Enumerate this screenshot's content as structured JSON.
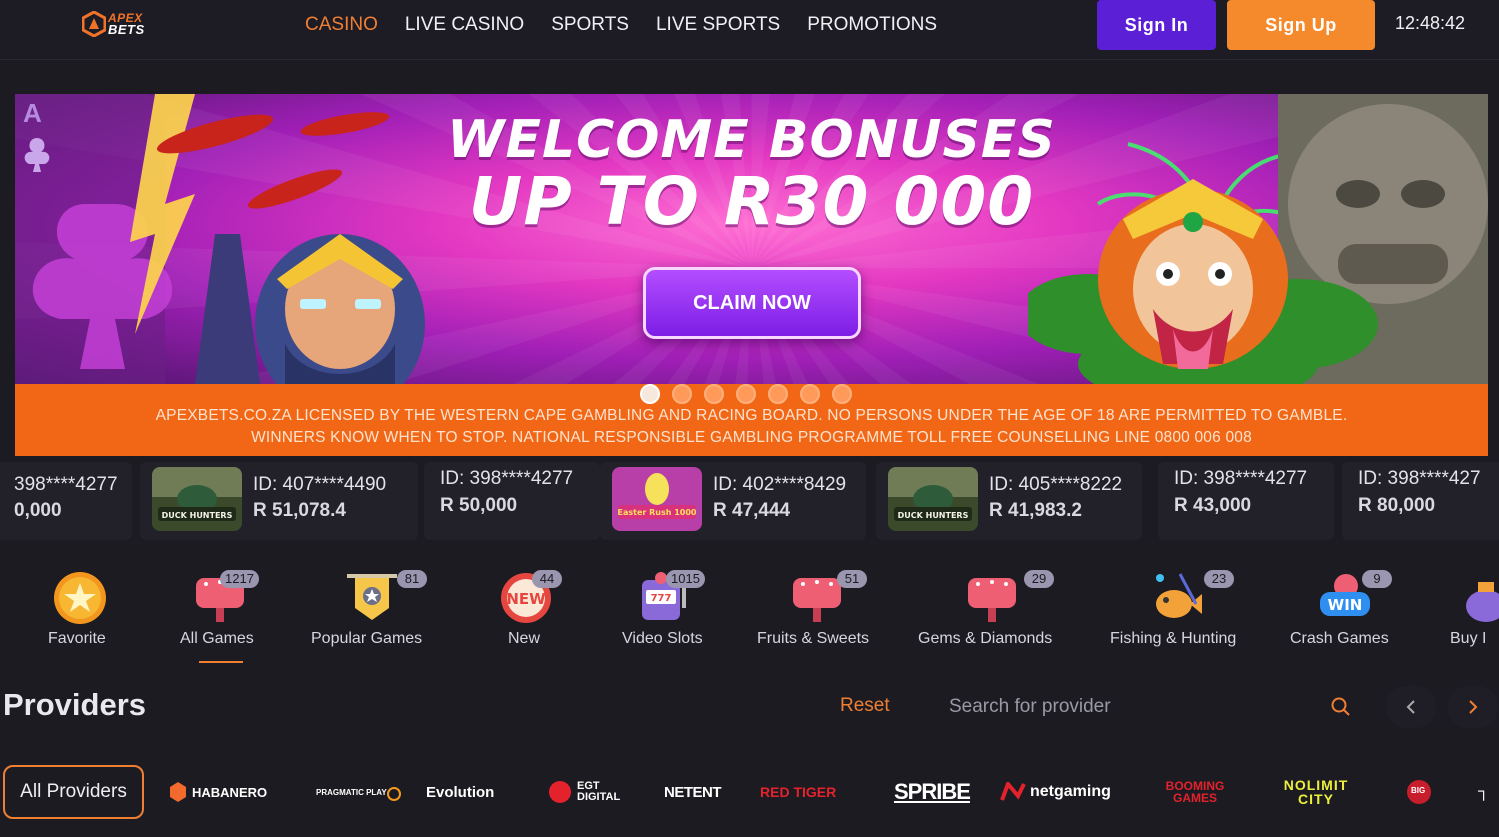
{
  "header": {
    "logo_line1": "APEX",
    "logo_line2": "BETS",
    "nav": [
      "CASINO",
      "LIVE CASINO",
      "SPORTS",
      "LIVE SPORTS",
      "PROMOTIONS"
    ],
    "active_nav": "CASINO",
    "signin_label": "Sign In",
    "signup_label": "Sign Up",
    "clock": "12:48:42"
  },
  "banner": {
    "title_line1": "WELCOME BONUSES",
    "title_line2": "UP TO R30 000",
    "cta": "CLAIM NOW",
    "slide_count": 7,
    "active_slide": 1,
    "license_line1": "APEXBETS.CO.ZA LICENSED BY THE WESTERN CAPE GAMBLING AND RACING BOARD. NO PERSONS UNDER THE AGE OF 18 ARE PERMITTED TO GAMBLE.",
    "license_line2": "WINNERS KNOW WHEN TO STOP. NATIONAL RESPONSIBLE GAMBLING PROGRAMME TOLL FREE COUNSELLING LINE 0800 006 008"
  },
  "winners": [
    {
      "id": "398****4277",
      "amount": "0,000",
      "thumb": null
    },
    {
      "id": "ID: 407****4490",
      "amount": "R 51,078.4",
      "thumb": "DUCK HUNTERS"
    },
    {
      "id": "ID: 398****4277",
      "amount": "R 50,000",
      "thumb": null
    },
    {
      "id": "ID: 402****8429",
      "amount": "R 47,444",
      "thumb": "Easter Rush 1000"
    },
    {
      "id": "ID: 405****8222",
      "amount": "R 41,983.2",
      "thumb": "DUCK HUNTERS"
    },
    {
      "id": "ID: 398****4277",
      "amount": "R 43,000",
      "thumb": null
    },
    {
      "id": "ID: 398****427",
      "amount": "R 80,000",
      "thumb": null
    }
  ],
  "categories": [
    {
      "label": "Favorite",
      "count": null
    },
    {
      "label": "All Games",
      "count": "1217"
    },
    {
      "label": "Popular Games",
      "count": "81"
    },
    {
      "label": "New",
      "count": "44"
    },
    {
      "label": "Video Slots",
      "count": "1015"
    },
    {
      "label": "Fruits & Sweets",
      "count": "51"
    },
    {
      "label": "Gems & Diamonds",
      "count": "29"
    },
    {
      "label": "Fishing & Hunting",
      "count": "23"
    },
    {
      "label": "Crash Games",
      "count": "9"
    },
    {
      "label": "Buy I",
      "count": null
    }
  ],
  "providers": {
    "title": "Providers",
    "reset": "Reset",
    "search_placeholder": "Search for provider",
    "all_label": "All Providers",
    "logos": [
      "HABANERO",
      "PRAGMATIC PLAY",
      "Evolution",
      "EGT DIGITAL",
      "NETENT",
      "RED TIGER",
      "SPRIBE",
      "netgaming",
      "BOOMING GAMES",
      "NOLIMIT CITY",
      "BIG"
    ]
  },
  "colors": {
    "accent": "#f07f33",
    "signin": "#5b1fd6",
    "signup": "#f48a2c",
    "license_bar": "#f26716",
    "background": "#1c1b22"
  }
}
